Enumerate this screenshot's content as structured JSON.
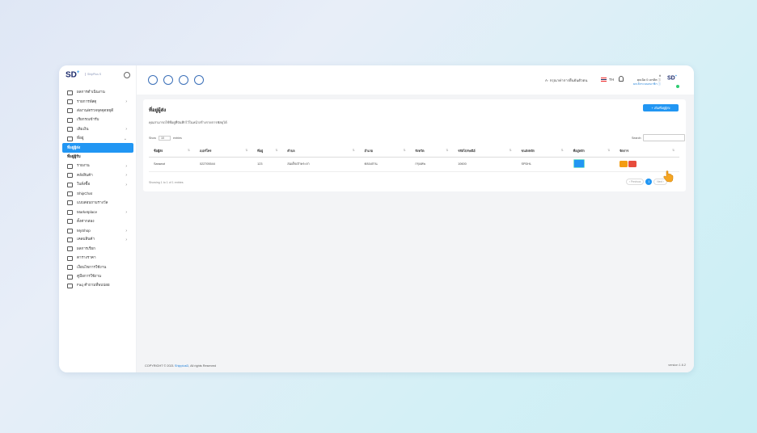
{
  "sidebar": {
    "logo": "SD",
    "logo_sup": "+",
    "logo_tag": "ShipPlus S",
    "items": [
      {
        "label": "ผลการดำเนินงาน",
        "icon": "home-icon",
        "chevron": ""
      },
      {
        "label": "รายการพัสดุ",
        "icon": "gear-icon",
        "chevron": "›"
      },
      {
        "label": "ส่งงาน/ตรวจจุดจุดหยุดี",
        "icon": "send-icon",
        "chevron": ""
      },
      {
        "label": "เรียกรถเข้ารับ",
        "icon": "truck-icon",
        "chevron": ""
      },
      {
        "label": "เติมเงิน",
        "icon": "wallet-icon",
        "chevron": "›"
      },
      {
        "label": "ที่อยู่",
        "icon": "map-icon",
        "chevron": "⌄"
      },
      {
        "label": "ที่อยู่ผู้ส่ง",
        "icon": "",
        "chevron": "",
        "active": true
      },
      {
        "label": "ที่อยู่ผู้รับ",
        "icon": "",
        "chevron": ""
      },
      {
        "label": "รายงาน",
        "icon": "folder-icon",
        "chevron": "›"
      },
      {
        "label": "คลังสินค้า",
        "icon": "box-icon",
        "chevron": "›"
      },
      {
        "label": "ใบสั่งซื้อ",
        "icon": "doc-icon",
        "chevron": "›"
      },
      {
        "label": "ShipChat",
        "icon": "chat-icon",
        "chevron": ""
      },
      {
        "label": "แบบสอบถามรางวัล",
        "icon": "doc-icon",
        "chevron": ""
      },
      {
        "label": "Marketplace",
        "icon": "cart-icon",
        "chevron": "›"
      },
      {
        "label": "ตั้งค่ากล่อง",
        "icon": "box-icon",
        "chevron": ""
      },
      {
        "label": "MyShop",
        "icon": "shop-icon",
        "chevron": "›"
      },
      {
        "label": "เคลมสินค้า",
        "icon": "tool-icon",
        "chevron": "›"
      },
      {
        "label": "ผลการเรียก",
        "icon": "circle-icon",
        "chevron": ""
      },
      {
        "label": "ตารางราคา",
        "icon": "list-icon",
        "chevron": ""
      },
      {
        "label": "เงื่อนไขการใช้งาน",
        "icon": "info-icon",
        "chevron": ""
      },
      {
        "label": "คู่มือการใช้งาน",
        "icon": "book-icon",
        "chevron": ""
      },
      {
        "label": "Faq คำถามที่พบบ่อย",
        "icon": "headset-icon",
        "chevron": ""
      }
    ]
  },
  "topbar": {
    "lang_notice": "A· กรุณาค่าการยืนยันตัวตน",
    "lang": "TH",
    "user_name": "คุณนิด 0 เครดิต ⓘ",
    "user_sub": "ยกเลิกระบบสมาชิก ⓘ",
    "user_top": "tt",
    "avatar": "SD",
    "avatar_sup": "+"
  },
  "page": {
    "title": "ที่อยู่ผู้ส่ง",
    "add_button": "+ เพิ่มที่อยู่ผู้ส่ง",
    "description": "คุณสามารถใช้ที่อยู่ที่บันทึกไว้ในหน้าสร้างรายการพัสดุได้",
    "show_label": "Show",
    "entries_value": "10",
    "entries_label": "entries",
    "search_label": "Search:",
    "columns": [
      "ชื่อผู้ส่ง",
      "เบอร์โทร",
      "ที่อยู่",
      "ตำบล",
      "อำเภอ",
      "จังหวัด",
      "รหัสไปรษณีย์",
      "ขนส่งหลัก",
      "ที่อยู่หลัก",
      "จัดการ"
    ],
    "rows": [
      {
        "name": "Sarawut",
        "phone": "022705544",
        "address": "123",
        "subdistrict": "สมเด็จเจ้าพระยา",
        "district": "คลองสาน",
        "province": "กรุงเทพ",
        "zip": "10600",
        "carrier": "SPDHL"
      }
    ],
    "info": "Showing 1 to 1 of 1 entries",
    "prev": "‹ Previous",
    "page_num": "1",
    "next": "Next ›"
  },
  "footer": {
    "copyright_prefix": "COPYRIGHT © 2021 ",
    "copyright_link": "ShippiusD",
    "copyright_suffix": ", All rights Reserved",
    "version": "version 1.6.2"
  },
  "colors": {
    "primary": "#2196f3",
    "warning": "#f39c12",
    "danger": "#e74c3c",
    "brand": "#1b2a6b"
  }
}
